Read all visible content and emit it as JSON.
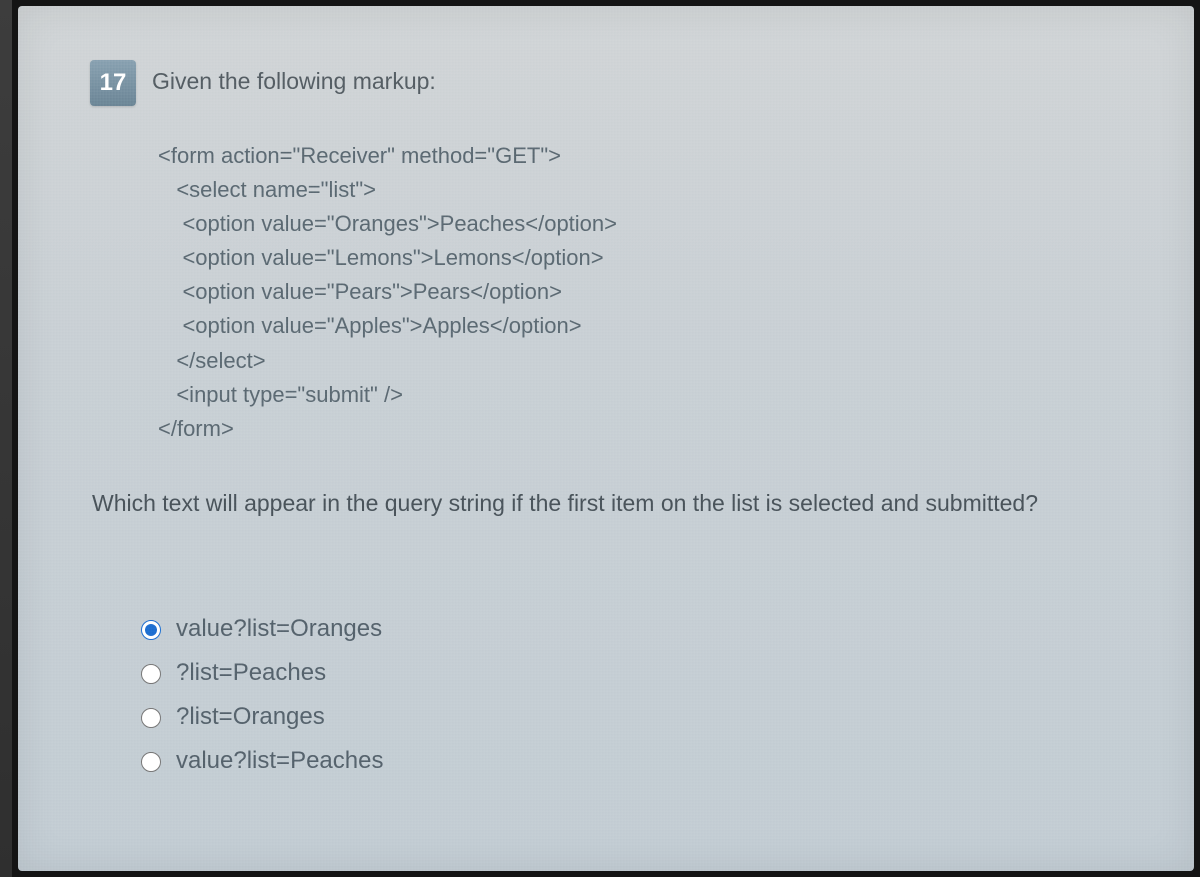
{
  "question": {
    "number": "17",
    "intro": "Given the following markup:",
    "code_lines": [
      "<form action=\"Receiver\" method=\"GET\">",
      "   <select name=\"list\">",
      "    <option value=\"Oranges\">Peaches</option>",
      "    <option value=\"Lemons\">Lemons</option>",
      "    <option value=\"Pears\">Pears</option>",
      "    <option value=\"Apples\">Apples</option>",
      "   </select>",
      "   <input type=\"submit\" />",
      "</form>"
    ],
    "prompt": "Which text will appear in the query string if the first item on the list is selected and submitted?",
    "choices": [
      {
        "label": "value?list=Oranges",
        "selected": true
      },
      {
        "label": "?list=Peaches",
        "selected": false
      },
      {
        "label": "?list=Oranges",
        "selected": false
      },
      {
        "label": "value?list=Peaches",
        "selected": false
      }
    ]
  }
}
